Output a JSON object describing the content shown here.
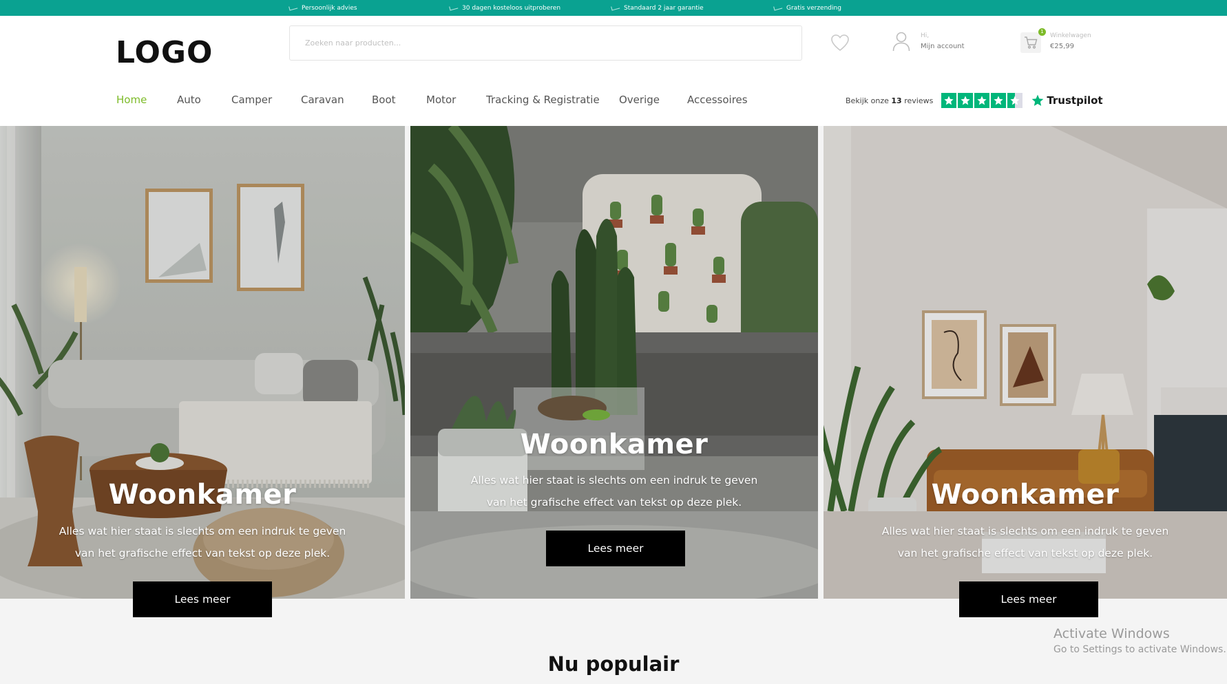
{
  "topbar": {
    "usps": [
      "Persoonlijk advies",
      "30 dagen kosteloos uitproberen",
      "Standaard 2 jaar garantie",
      "Gratis verzending"
    ]
  },
  "header": {
    "logo": "LOGO",
    "search_placeholder": "Zoeken naar producten...",
    "account": {
      "greeting": "Hi,",
      "label": "Mijn account"
    },
    "cart": {
      "count": "1",
      "label": "Winkelwagen",
      "total": "€25,99"
    }
  },
  "nav": {
    "items": [
      "Home",
      "Auto",
      "Camper",
      "Caravan",
      "Boot",
      "Motor",
      "Tracking & Registratie",
      "Overige",
      "Accessoires"
    ],
    "active": "Home"
  },
  "trustpilot": {
    "prefix": "Bekijk onze",
    "count": "13",
    "suffix": "reviews",
    "brand": "Trustpilot",
    "rating": 4.5
  },
  "hero": {
    "panels": [
      {
        "title": "Woonkamer",
        "line1": "Alles wat hier staat is slechts om een indruk te geven",
        "line2": "van het grafische effect van tekst op deze plek.",
        "button": "Lees meer"
      },
      {
        "title": "Woonkamer",
        "line1": "Alles wat hier staat is slechts om een indruk te geven",
        "line2": "van het grafische effect van tekst op deze plek.",
        "button": "Lees meer"
      },
      {
        "title": "Woonkamer",
        "line1": "Alles wat hier staat is slechts om een indruk te geven",
        "line2": "van het grafische effect van tekst op deze plek.",
        "button": "Lees meer"
      }
    ]
  },
  "popular": {
    "title": "Nu populair"
  },
  "os_watermark": {
    "line1": "Activate Windows",
    "line2": "Go to Settings to activate Windows."
  },
  "colors": {
    "topbar": "#0aa291",
    "accent": "#7dbb29",
    "trustpilot": "#00b67a",
    "button": "#000000"
  },
  "icons": [
    "check-icon",
    "heart-icon",
    "user-icon",
    "cart-icon",
    "trustpilot-star-icon"
  ]
}
